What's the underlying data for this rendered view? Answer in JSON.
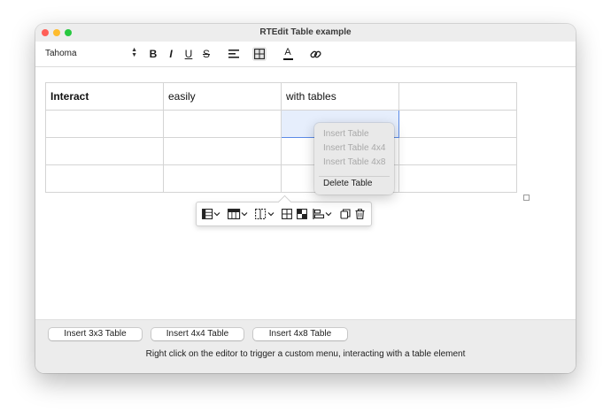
{
  "window": {
    "title": "RTEdit Table example"
  },
  "toolbar": {
    "font_name": "Tahoma",
    "icons": [
      "bold-icon",
      "italic-icon",
      "underline-icon",
      "strikethrough-icon",
      "align-left-icon",
      "table-icon",
      "text-color-icon",
      "link-icon"
    ],
    "bold_glyph": "B",
    "italic_glyph": "I",
    "underline_glyph": "U",
    "strike_glyph": "S",
    "textcolor_glyph": "A"
  },
  "table": {
    "rows": [
      [
        "Interact",
        "easily",
        "with tables",
        ""
      ],
      [
        "",
        "",
        "",
        ""
      ],
      [
        "",
        "",
        "",
        ""
      ],
      [
        "",
        "",
        "",
        ""
      ]
    ]
  },
  "table_toolbar": {
    "icons": [
      "row-options-icon",
      "column-options-icon",
      "cell-options-icon",
      "merge-cells-icon",
      "split-cells-icon",
      "align-cells-icon",
      "copy-table-icon",
      "delete-table-icon"
    ]
  },
  "context_menu": {
    "items": [
      {
        "label": "Insert Table",
        "enabled": false
      },
      {
        "label": "Insert Table 4x4",
        "enabled": false
      },
      {
        "label": "Insert Table 4x8",
        "enabled": false
      },
      {
        "label": "Delete Table",
        "enabled": true
      }
    ]
  },
  "footer": {
    "buttons": [
      "Insert 3x3 Table",
      "Insert 4x4 Table",
      "Insert 4x8 Table"
    ],
    "hint": "Right click on the editor to trigger a custom menu, interacting with a table element"
  },
  "colors": {
    "close": "#ff5f57",
    "minimize": "#febc2e",
    "maximize": "#28c840",
    "selection": "#5b8ae6",
    "text_color_underline": "#111111"
  }
}
